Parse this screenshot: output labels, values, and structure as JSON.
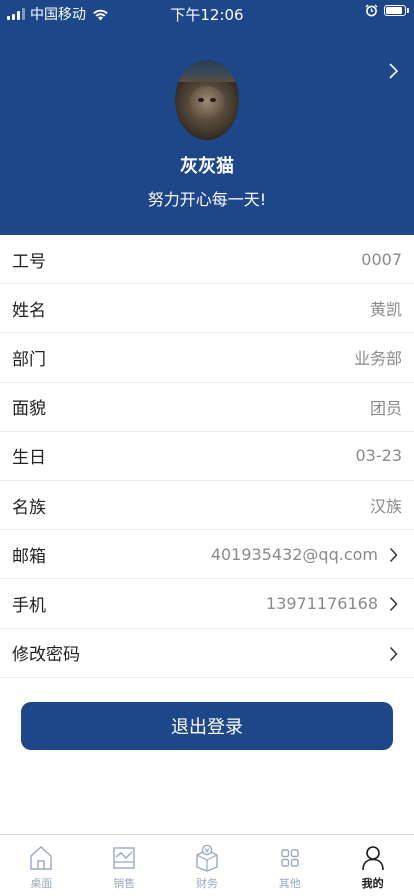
{
  "status_bar": {
    "carrier": "中国移动",
    "time": "下午12:06"
  },
  "profile": {
    "name": "灰灰猫",
    "motto": "努力开心每一天!"
  },
  "info_rows": [
    {
      "label": "工号",
      "value": "0007"
    },
    {
      "label": "姓名",
      "value": "黄凯"
    },
    {
      "label": "部门",
      "value": "业务部"
    },
    {
      "label": "面貌",
      "value": "团员"
    },
    {
      "label": "生日",
      "value": "03-23"
    },
    {
      "label": "名族",
      "value": "汉族"
    },
    {
      "label": "邮箱",
      "value": "401935432@qq.com"
    },
    {
      "label": "手机",
      "value": "13971176168"
    },
    {
      "label": "修改密码",
      "value": ""
    }
  ],
  "logout_label": "退出登录",
  "tabs": [
    {
      "label": "桌面",
      "icon": "home-icon"
    },
    {
      "label": "销售",
      "icon": "sales-chart-icon"
    },
    {
      "label": "财务",
      "icon": "finance-money-icon"
    },
    {
      "label": "其他",
      "icon": "grid-apps-icon"
    },
    {
      "label": "我的",
      "icon": "person-icon",
      "active": true
    }
  ],
  "colors": {
    "brand": "#1d4789",
    "tab_inactive": "#9aa9bf",
    "tab_active": "#1a1a1a"
  }
}
